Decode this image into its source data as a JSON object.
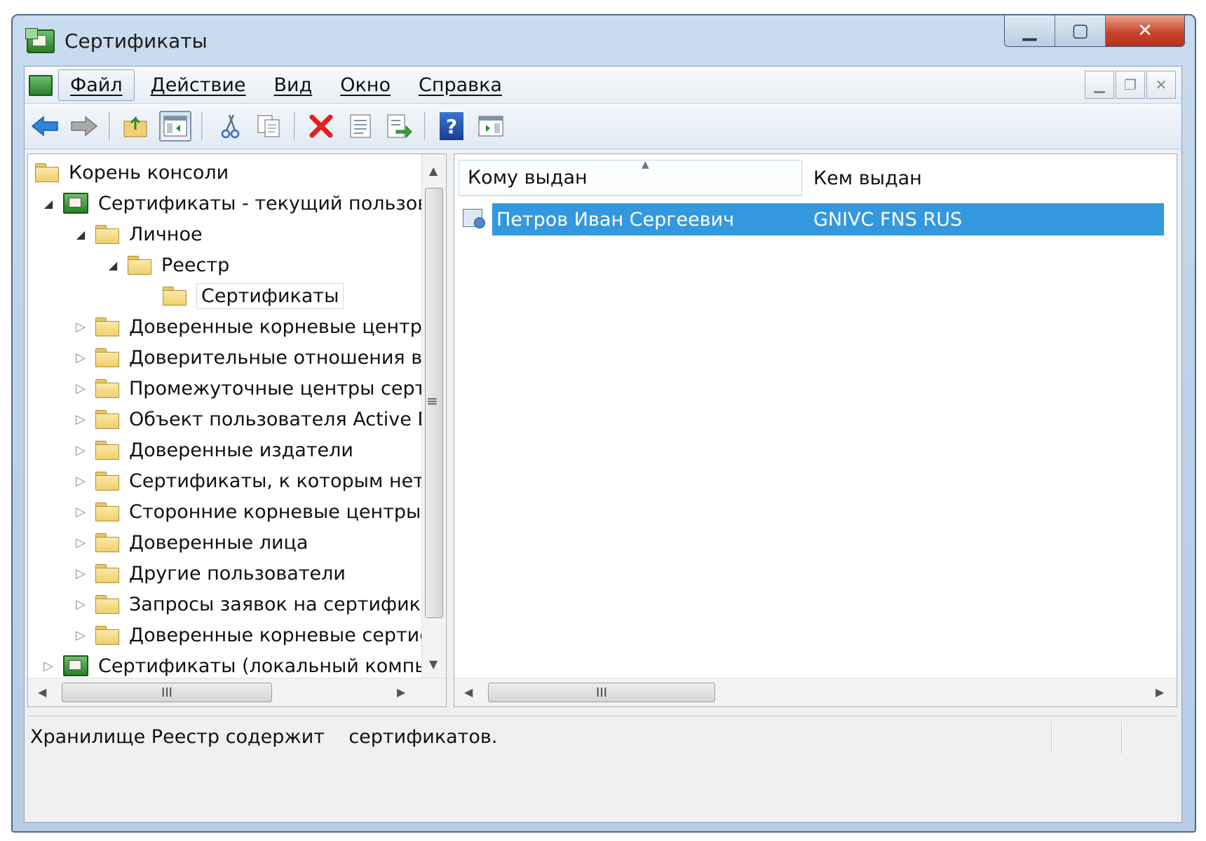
{
  "window": {
    "title": "Сертификаты",
    "caption": {
      "minimize": "▁",
      "maximize": "▢",
      "close": "✕"
    }
  },
  "menu": {
    "items": [
      "Файл",
      "Действие",
      "Вид",
      "Окно",
      "Справка"
    ],
    "active": "Файл",
    "mdi": {
      "minimize": "▁",
      "restore": "❐",
      "close": "✕"
    }
  },
  "toolbar": {
    "buttons": [
      "back-arrow-icon",
      "forward-arrow-icon",
      "up-folder-icon",
      "show-hide-tree-icon",
      "cut-icon",
      "copy-icon",
      "delete-icon",
      "properties-icon",
      "export-icon",
      "help-icon",
      "show-action-pane-icon"
    ],
    "help_glyph": "?"
  },
  "tree": {
    "root": "Корень консоли",
    "current_user": "Сертификаты - текущий пользов",
    "personal": "Личное",
    "registry": "Реестр",
    "certificates": "Сертификаты",
    "trusted_root": "Доверенные корневые центрі",
    "enterprise_trust": "Доверительные отношения в",
    "intermediate": "Промежуточные центры серт",
    "ad_user_object": "Объект пользователя Active D",
    "trusted_publishers": "Доверенные издатели",
    "untrusted": "Сертификаты, к которым нет",
    "third_party_root": "Сторонние корневые центры",
    "trusted_people": "Доверенные лица",
    "other_people": "Другие пользователи",
    "cert_enrollment_requests": "Запросы заявок на сертифика",
    "smart_card_root": "Доверенные корневые сертис",
    "local_computer": "Сертификаты (локальный компь"
  },
  "list": {
    "columns": {
      "issued_to": "Кому выдан",
      "issued_by": "Кем выдан"
    },
    "rows": [
      {
        "issued_to": "Петров Иван Сергеевич",
        "issued_by": "GNIVC FNS RUS"
      }
    ]
  },
  "scroll": {
    "grip_v": "≡",
    "grip_h": "III",
    "up": "▲",
    "down": "▼",
    "left": "◀",
    "right": "▶"
  },
  "status": {
    "text": "Хранилище Реестр содержит    сертификатов."
  },
  "colors": {
    "selection": "#3398de",
    "window_frame": "#bed3ea",
    "delete_red": "#e02020"
  }
}
